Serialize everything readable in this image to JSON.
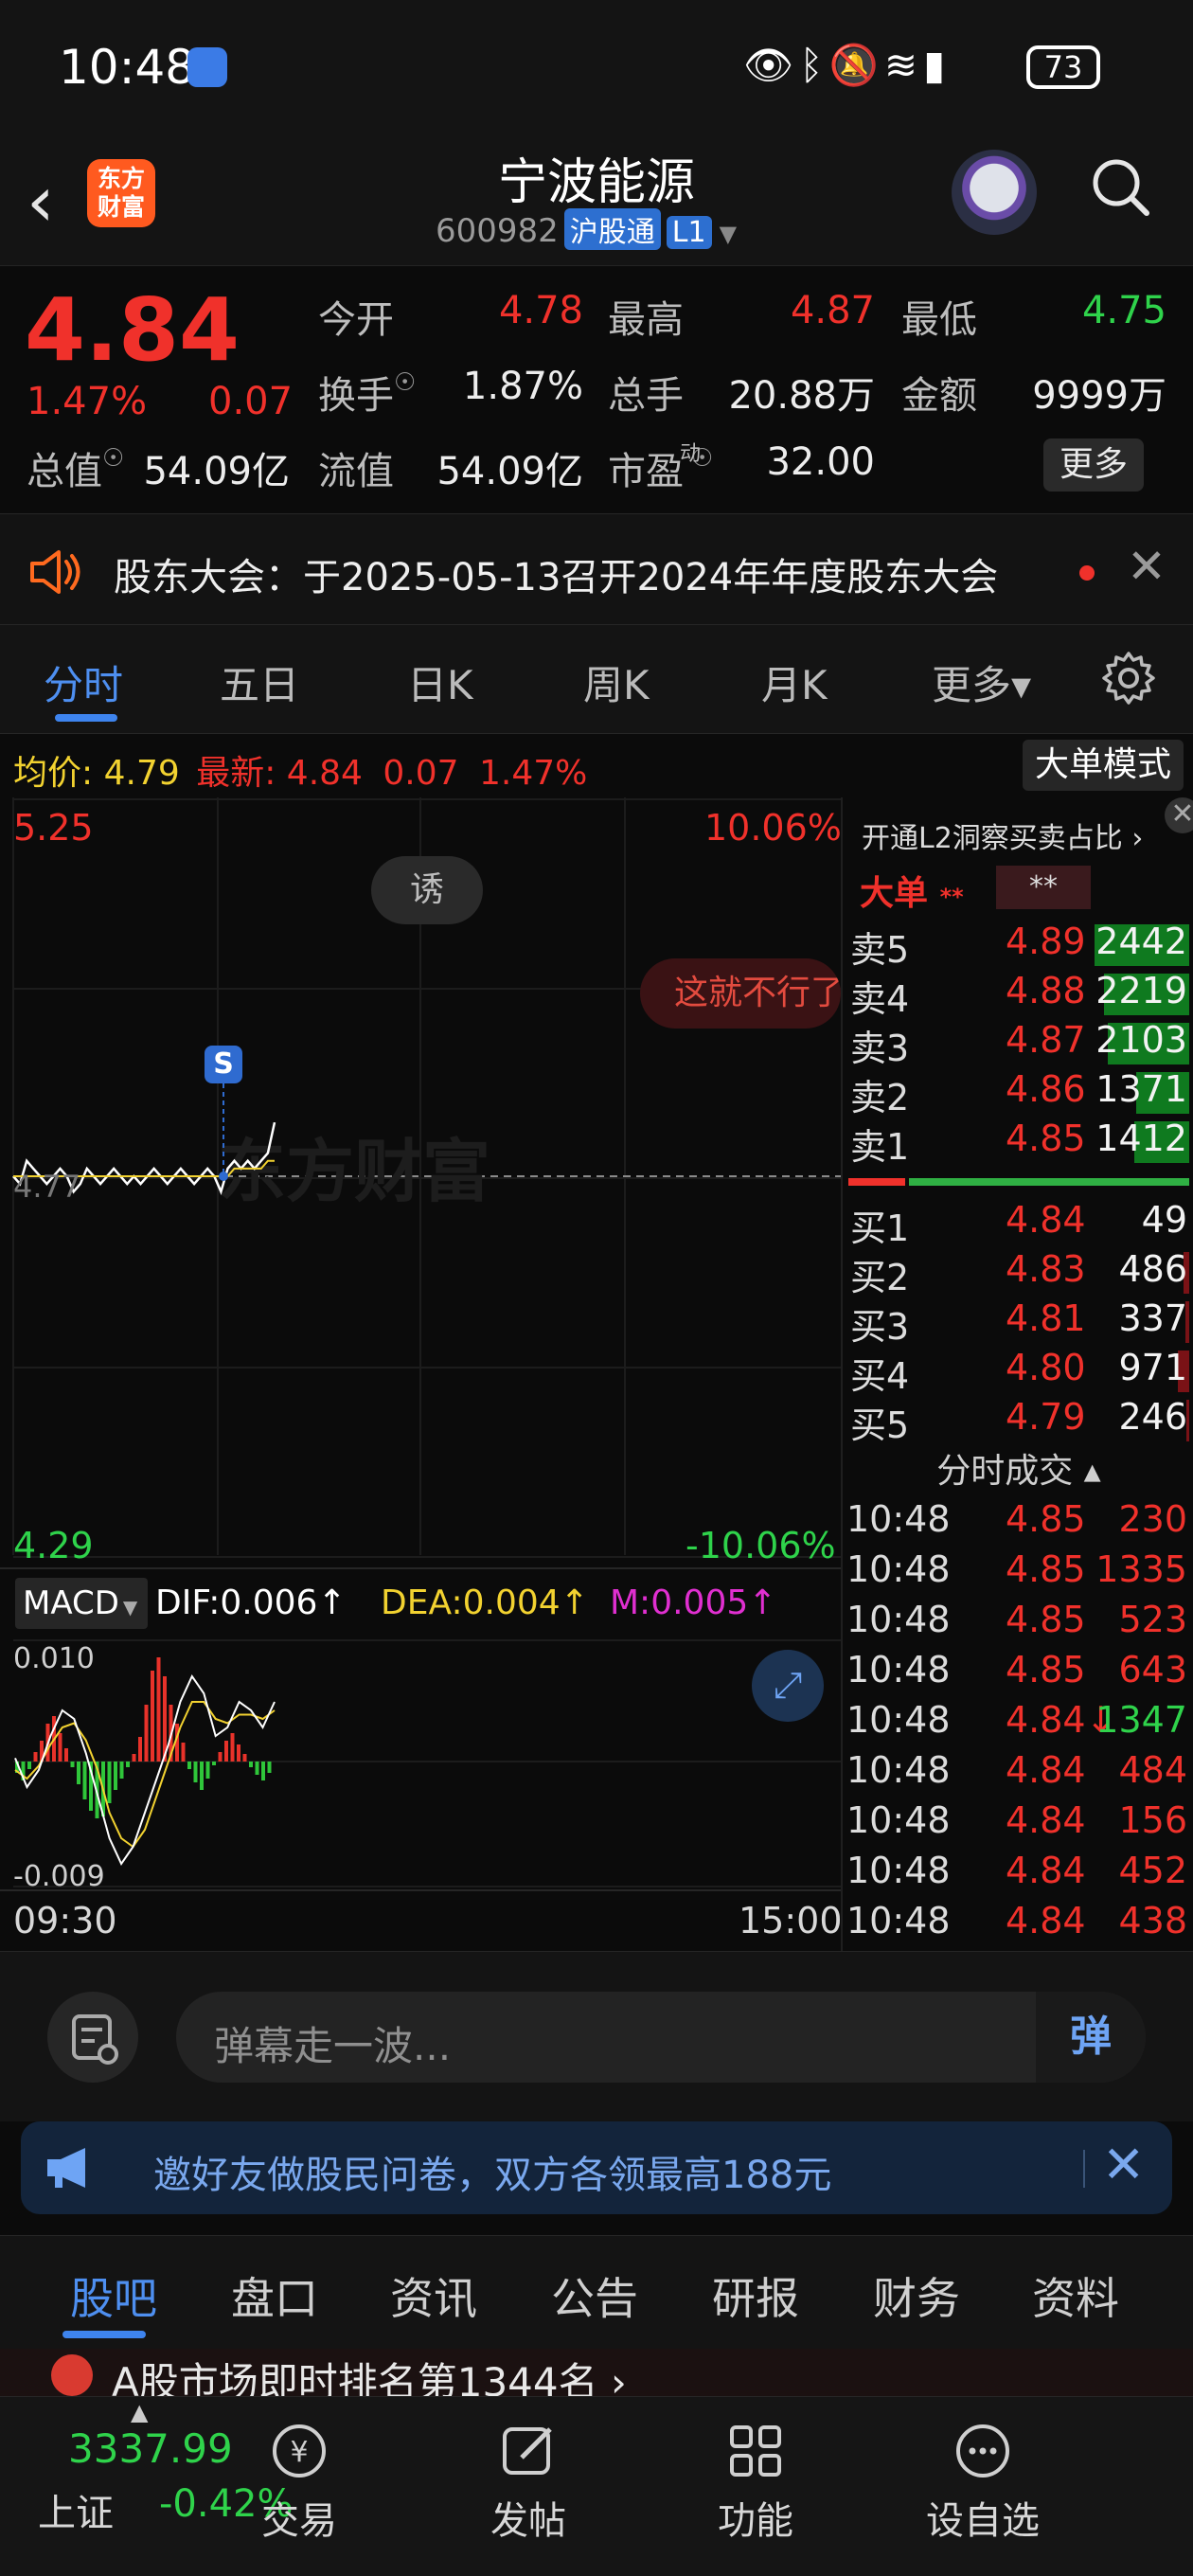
{
  "status_bar": {
    "time": "10:48",
    "battery": "73"
  },
  "header": {
    "back_glyph": "‹",
    "logo_text": "东方财富",
    "title": "宁波能源",
    "code": "600982",
    "market_tag": "沪股通",
    "level_tag": "L1",
    "icons": [
      "robot-avatar-icon",
      "search-icon"
    ]
  },
  "quote": {
    "price": "4.84",
    "change_pct": "1.47%",
    "change": "0.07",
    "rows": [
      [
        {
          "label": "今开",
          "value": "4.78",
          "color": "red"
        },
        {
          "label": "最高",
          "value": "4.87",
          "color": "red"
        },
        {
          "label": "最低",
          "value": "4.75",
          "color": "green"
        }
      ],
      [
        {
          "label": "换手",
          "value": "1.87%",
          "color": "white"
        },
        {
          "label": "总手",
          "value": "20.88万",
          "color": "white"
        },
        {
          "label": "金额",
          "value": "9999万",
          "color": "white"
        }
      ],
      [
        {
          "label": "总值",
          "value": "54.09亿",
          "color": "white"
        },
        {
          "label": "流值",
          "value": "54.09亿",
          "color": "white"
        },
        {
          "label": "市盈",
          "value": "32.00",
          "color": "white",
          "superscript": "动"
        }
      ]
    ],
    "more_label": "更多"
  },
  "notice": {
    "text": "股东大会：于2025-05-13召开2024年年度股东大会"
  },
  "tabs": {
    "items": [
      "分时",
      "五日",
      "日K",
      "周K",
      "月K",
      "更多▾"
    ],
    "active_index": 0
  },
  "info_line": {
    "avg_label": "均价:",
    "avg_value": "4.79",
    "latest_label": "最新:",
    "latest_value": "4.84",
    "change": "0.07",
    "change_pct": "1.47%",
    "big_order_mode": "大单模式"
  },
  "chart": {
    "y_max_label": "5.25",
    "y_min_label": "4.29",
    "pct_max_label": "10.06%",
    "pct_min_label": "-10.06%",
    "prev_close_label": "4.77",
    "bubble_text": "诱",
    "danmaku": "这就不行了",
    "marker_label": "S",
    "watermark": "东方财富",
    "time_start": "09:30",
    "time_end": "15:00",
    "macd": {
      "selector": "MACD",
      "dif": "DIF:0.006↑",
      "dea": "DEA:0.004↑",
      "m": "M:0.005↑",
      "y_top": "0.010",
      "y_bottom": "-0.009"
    }
  },
  "chart_data": {
    "type": "line",
    "title": "",
    "xlabel": "",
    "ylabel": "",
    "x_range": [
      "09:30",
      "15:00"
    ],
    "ylim": [
      4.29,
      5.25
    ],
    "prev_close": 4.77,
    "series": [
      {
        "name": "",
        "color": "#ffffff",
        "values": [
          4.77,
          4.76,
          4.79,
          4.78,
          4.77,
          4.76,
          4.77,
          4.78,
          4.77,
          4.75,
          4.76,
          4.78,
          4.77,
          4.76,
          4.77,
          4.78,
          4.77,
          4.76,
          4.77,
          4.76,
          4.77,
          4.78,
          4.77,
          4.76,
          4.77,
          4.78,
          4.77,
          4.76,
          4.77,
          4.78,
          4.77,
          4.75,
          4.78,
          4.79,
          4.78,
          4.79,
          4.78,
          4.79,
          4.8,
          4.84
        ]
      },
      {
        "name": "",
        "color": "#f2d230",
        "values": [
          4.77,
          4.77,
          4.77,
          4.77,
          4.77,
          4.77,
          4.77,
          4.77,
          4.77,
          4.77,
          4.77,
          4.77,
          4.77,
          4.77,
          4.77,
          4.77,
          4.77,
          4.77,
          4.77,
          4.77,
          4.77,
          4.77,
          4.77,
          4.77,
          4.77,
          4.77,
          4.77,
          4.77,
          4.77,
          4.77,
          4.77,
          4.77,
          4.77,
          4.78,
          4.78,
          4.78,
          4.78,
          4.78,
          4.79,
          4.79
        ]
      }
    ]
  },
  "order_book": {
    "l2_title": "开通L2洞察买卖占比 ›",
    "dadan_label": "大单",
    "dadan_stars": "**",
    "dadan_box": "**",
    "asks": [
      {
        "label": "卖5",
        "price": "4.89",
        "vol": "2442",
        "ratio": 1.0
      },
      {
        "label": "卖4",
        "price": "4.88",
        "vol": "2219",
        "ratio": 0.9
      },
      {
        "label": "卖3",
        "price": "4.87",
        "vol": "2103",
        "ratio": 0.86
      },
      {
        "label": "卖2",
        "price": "4.86",
        "vol": "1371",
        "ratio": 0.56
      },
      {
        "label": "卖1",
        "price": "4.85",
        "vol": "1412",
        "ratio": 0.58
      }
    ],
    "bids": [
      {
        "label": "买1",
        "price": "4.84",
        "vol": "49",
        "ratio": 0.0
      },
      {
        "label": "买2",
        "price": "4.83",
        "vol": "486",
        "ratio": 0.06
      },
      {
        "label": "买3",
        "price": "4.81",
        "vol": "337",
        "ratio": 0.04
      },
      {
        "label": "买4",
        "price": "4.80",
        "vol": "971",
        "ratio": 0.12
      },
      {
        "label": "买5",
        "price": "4.79",
        "vol": "246",
        "ratio": 0.03
      }
    ],
    "trade_title": "分时成交 ▴",
    "trades": [
      {
        "time": "10:48",
        "price": "4.85",
        "vol": "230",
        "dir": "up"
      },
      {
        "time": "10:48",
        "price": "4.85",
        "vol": "1335",
        "dir": "up"
      },
      {
        "time": "10:48",
        "price": "4.85",
        "vol": "523",
        "dir": "up"
      },
      {
        "time": "10:48",
        "price": "4.85",
        "vol": "643",
        "dir": "up"
      },
      {
        "time": "10:48",
        "price": "4.84↓",
        "vol": "1347",
        "dir": "down"
      },
      {
        "time": "10:48",
        "price": "4.84",
        "vol": "484",
        "dir": "up"
      },
      {
        "time": "10:48",
        "price": "4.84",
        "vol": "156",
        "dir": "up"
      },
      {
        "time": "10:48",
        "price": "4.84",
        "vol": "452",
        "dir": "up"
      },
      {
        "time": "10:48",
        "price": "4.84",
        "vol": "438",
        "dir": "up"
      }
    ]
  },
  "comment": {
    "placeholder": "弹幕走一波...",
    "send_label": "弹"
  },
  "promo": {
    "text": "邀好友做股民问卷，双方各领最高188元"
  },
  "sub_tabs": {
    "items": [
      "股吧",
      "盘口",
      "资讯",
      "公告",
      "研报",
      "财务",
      "资料"
    ],
    "active_index": 0
  },
  "peek": {
    "text": "A股市场即时排名第1344名 ›"
  },
  "navbar": {
    "index_value": "3337.99",
    "index_name": "上证",
    "index_change": "-0.42%",
    "items": [
      {
        "label": "交易",
        "icon": "trade-yuan-icon"
      },
      {
        "label": "发帖",
        "icon": "edit-post-icon"
      },
      {
        "label": "功能",
        "icon": "grid-apps-icon"
      },
      {
        "label": "设自选",
        "icon": "more-dots-icon"
      }
    ]
  },
  "colors": {
    "up": "#f0312b",
    "down": "#2fd34b",
    "accent": "#4e8ff0",
    "avg_line": "#f2d230",
    "background": "#0b0b0b"
  }
}
